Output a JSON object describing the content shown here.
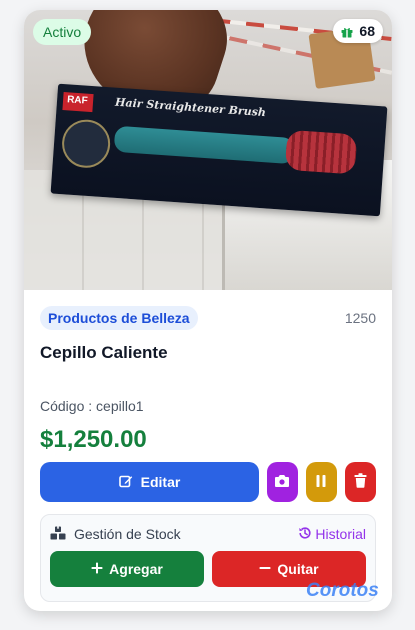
{
  "product": {
    "status": "Activo",
    "stock_count": "68",
    "category": "Productos de Belleza",
    "reference": "1250",
    "title": "Cepillo Caliente",
    "code_label": "Código : cepillo1",
    "price": "$1,250.00",
    "image_text": {
      "brand": "RAF",
      "name": "Hair Straightener Brush"
    }
  },
  "actions": {
    "edit_label": "Editar"
  },
  "stock": {
    "title": "Gestión de Stock",
    "history_label": "Historial",
    "add_label": "Agregar",
    "remove_label": "Quitar"
  },
  "watermark": "Corotos",
  "colors": {
    "status_bg": "#dcfce7",
    "status_text": "#15803d",
    "primary": "#2b63e4",
    "camera": "#a022e0",
    "pause": "#d39a0b",
    "danger": "#dc2626",
    "success": "#15803d",
    "history": "#9333ea",
    "category_bg": "#e8f0fd",
    "category_text": "#1d4ed8"
  },
  "icons": [
    "gift-icon",
    "edit-icon",
    "camera-icon",
    "pause-icon",
    "trash-icon",
    "inventory-icon",
    "history-icon",
    "plus-icon",
    "minus-icon"
  ]
}
